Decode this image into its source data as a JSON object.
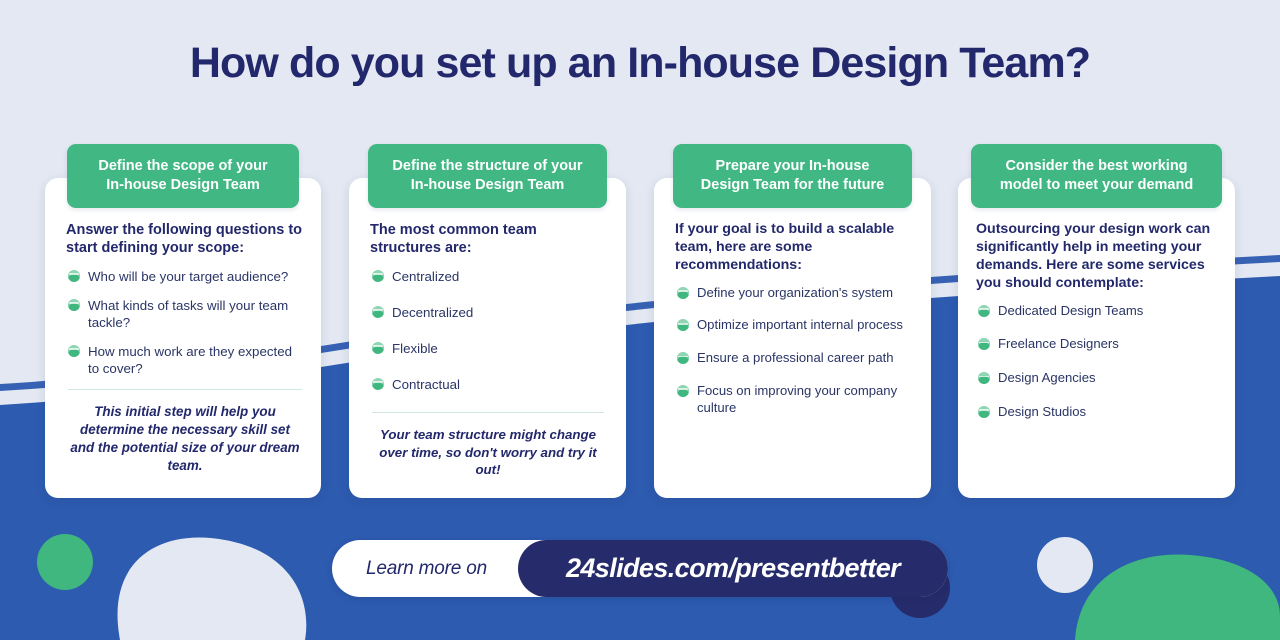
{
  "page": {
    "title": "How do you set up an In-house Design Team?",
    "colors": {
      "background_top": "#e3e8f2",
      "background_blue": "#2d5bb0",
      "accent_green": "#41b884",
      "navy": "#22286b",
      "card_white": "#ffffff"
    }
  },
  "cards": [
    {
      "heading": "Define the scope of your\nIn-house Design Team",
      "heading_line1": "Define the scope of your",
      "heading_line2": "In-house Design Team",
      "intro": "Answer the following questions to start defining your scope:",
      "bullets": [
        "Who will be your target audience?",
        "What kinds of tasks will your team tackle?",
        "How much work are they expected to cover?"
      ],
      "has_note": true,
      "note": "This initial step will help you determine the necessary skill set and the potential size of your dream team."
    },
    {
      "heading_line1": "Define the structure of your",
      "heading_line2": "In-house Design Team",
      "intro": "The most common team structures are:",
      "bullets": [
        "Centralized",
        "Decentralized",
        "Flexible",
        "Contractual"
      ],
      "has_note": true,
      "note": "Your team structure might change over time, so don't worry and try it out!"
    },
    {
      "heading_line1": "Prepare your In-house",
      "heading_line2": "Design Team for the future",
      "intro": "If your goal is to build a scalable team, here are some recommendations:",
      "bullets": [
        "Define your organization's system",
        "Optimize important internal process",
        "Ensure a professional career path",
        "Focus on improving your company culture"
      ],
      "has_note": false,
      "note": ""
    },
    {
      "heading_line1": "Consider the best working",
      "heading_line2": "model to meet your demand",
      "intro": "Outsourcing your design work can significantly help in meeting your demands. Here are some services you should contemplate:",
      "bullets": [
        "Dedicated Design Teams",
        "Freelance Designers",
        "Design Agencies",
        "Design Studios"
      ],
      "has_note": false,
      "note": ""
    }
  ],
  "footer": {
    "learn_more_label": "Learn more on",
    "url": "24slides.com/presentbetter"
  }
}
